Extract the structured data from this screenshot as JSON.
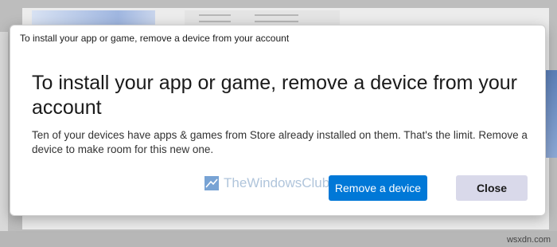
{
  "dialog": {
    "title": "To install your app or game, remove a device from your account",
    "heading": "To install your app or game, remove a device from your account",
    "message": "Ten of your devices have apps & games from Store already installed on them. That's the limit. Remove a device to make room for this new one.",
    "primary_button": "Remove a device",
    "secondary_button": "Close"
  },
  "watermark": {
    "text": "TheWindowsClub"
  },
  "footer": {
    "site": "wsxdn.com"
  },
  "colors": {
    "accent": "#0078d7",
    "secondary_button": "#d9d9ea",
    "watermark": "#a8bfd8"
  }
}
